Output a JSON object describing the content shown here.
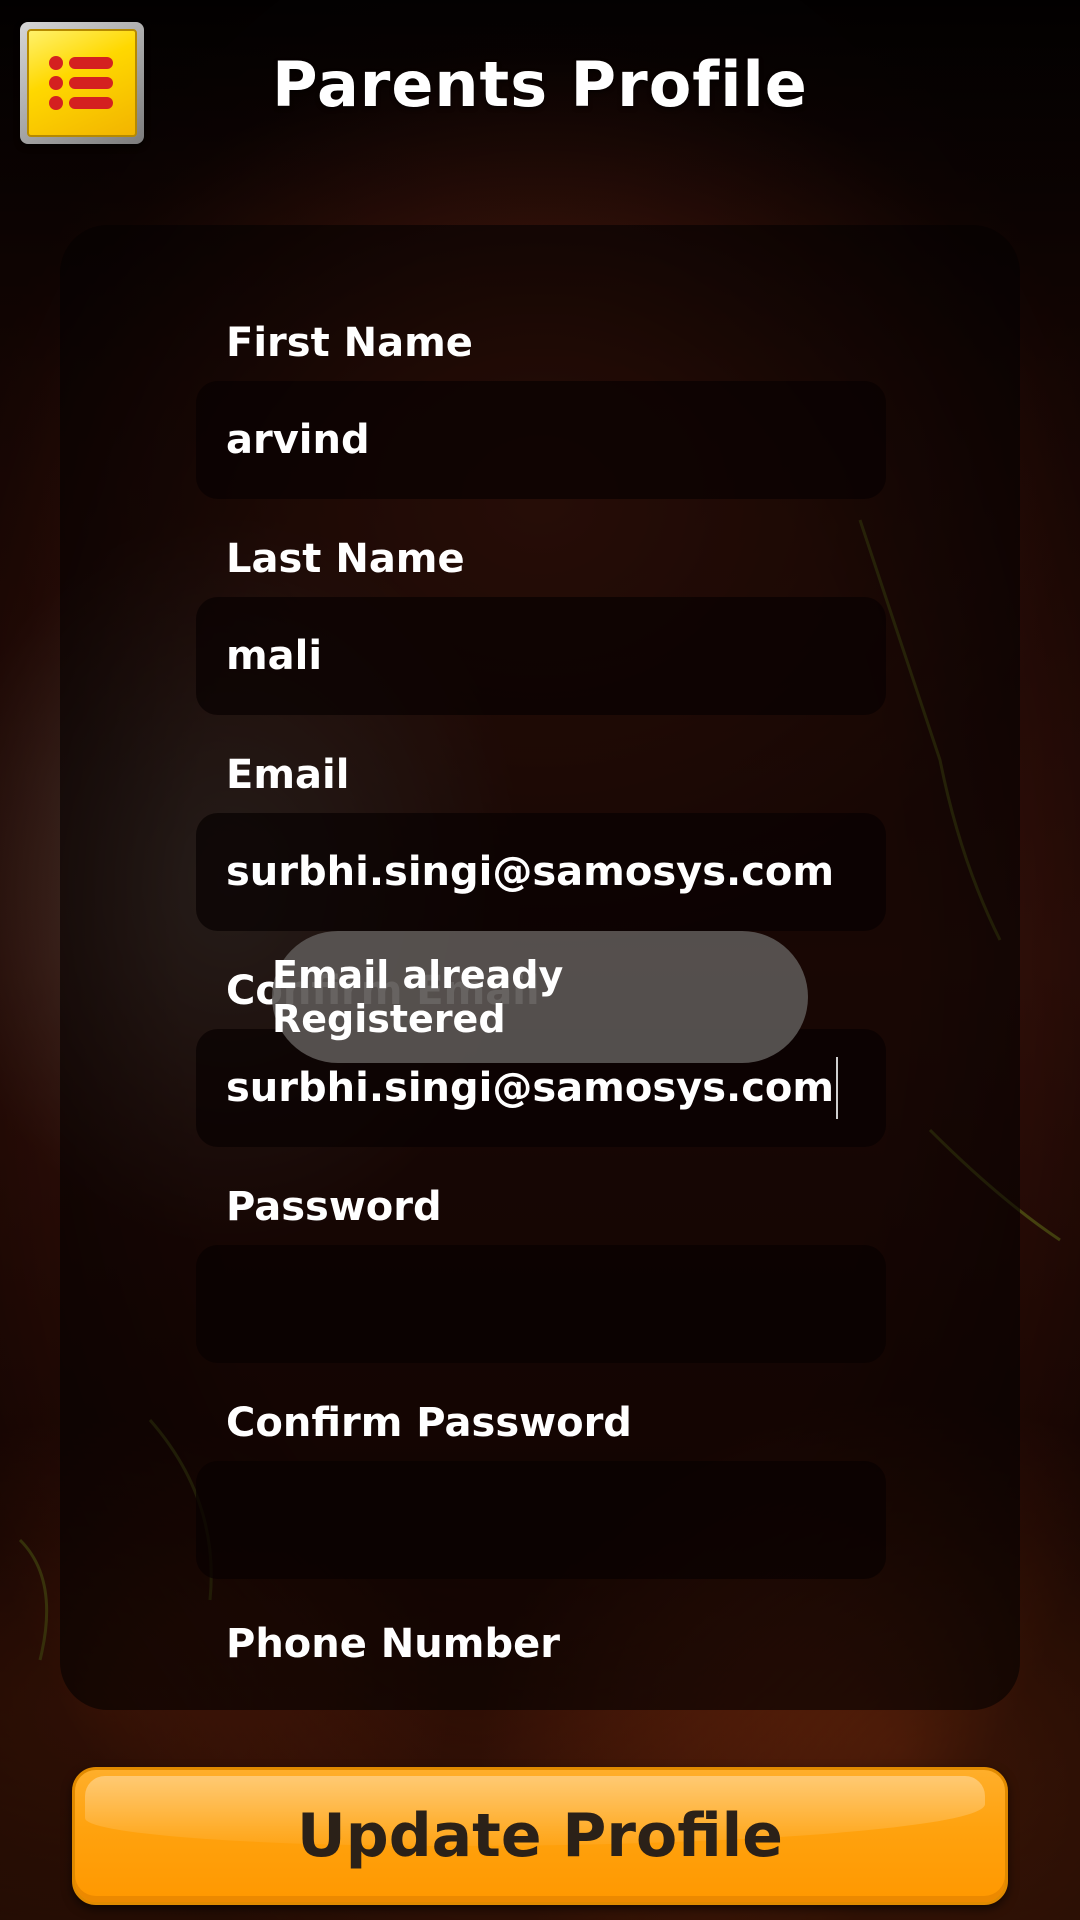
{
  "header": {
    "title": "Parents Profile",
    "menu_icon": "list-menu-icon"
  },
  "form": {
    "fields": [
      {
        "label": "First Name",
        "value": "arvind"
      },
      {
        "label": "Last Name",
        "value": "mali"
      },
      {
        "label": "Email",
        "value": "surbhi.singi@samosys.com"
      },
      {
        "label": "Confirm Email",
        "value": "surbhi.singi@samosys.com"
      },
      {
        "label": "Password",
        "value": ""
      },
      {
        "label": "Confirm Password",
        "value": ""
      },
      {
        "label": "Phone Number",
        "value": ""
      }
    ]
  },
  "toast": {
    "message": "Email already Registered"
  },
  "footer": {
    "update_label": "Update Profile"
  },
  "colors": {
    "accent": "#ffa20e",
    "menu_yellow": "#ffd800",
    "menu_bullets": "#d42020"
  }
}
